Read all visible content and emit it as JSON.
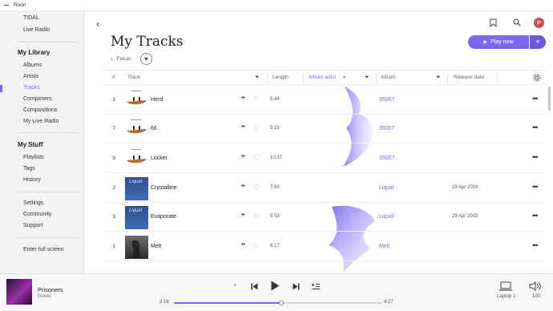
{
  "window": {
    "title": "Roon"
  },
  "sidebar": {
    "top_items": [
      {
        "label": "TIDAL"
      },
      {
        "label": "Live Radio"
      }
    ],
    "library_heading": "My Library",
    "library_items": [
      {
        "label": "Albums"
      },
      {
        "label": "Artists"
      },
      {
        "label": "Tracks",
        "active": true
      },
      {
        "label": "Composers"
      },
      {
        "label": "Compositions"
      },
      {
        "label": "My Live Radio"
      }
    ],
    "stuff_heading": "My Stuff",
    "stuff_items": [
      {
        "label": "Playlists"
      },
      {
        "label": "Tags"
      },
      {
        "label": "History"
      }
    ],
    "misc_items": [
      {
        "label": "Settings"
      },
      {
        "label": "Community"
      },
      {
        "label": "Support"
      }
    ],
    "fullscreen": "Enter full screen"
  },
  "header": {
    "title": "My Tracks",
    "focus_label": "Focus",
    "avatar_initial": "P",
    "play_label": "Play now"
  },
  "columns": {
    "num": "#",
    "track": "Track",
    "length": "Length",
    "album_artist": "Album artist",
    "album": "Album",
    "release_date": "Release date"
  },
  "tracks": [
    {
      "num": "1",
      "title": "Herd",
      "length": "5:44",
      "album": "35007",
      "date": "",
      "art": "canoe"
    },
    {
      "num": "7",
      "title": "66",
      "length": "5:15",
      "album": "35007",
      "date": "",
      "art": "canoe"
    },
    {
      "num": "9",
      "title": "Locker",
      "length": "10:37",
      "album": "35007",
      "date": "",
      "art": "canoe"
    },
    {
      "num": "2",
      "title": "Crystalline",
      "length": "7:50",
      "album": "Liquid",
      "date": "29 Apr 2003",
      "art": "liquid"
    },
    {
      "num": "3",
      "title": "Evaporate",
      "length": "5:53",
      "album": "Liquid",
      "date": "29 Apr 2003",
      "art": "liquid"
    },
    {
      "num": "1",
      "title": "Melt",
      "length": "6:17",
      "album": "Melt",
      "date": "",
      "art": "melt"
    }
  ],
  "player": {
    "title": "Prisoners",
    "artist": "Doves",
    "elapsed": "2:18",
    "total": "4:27",
    "progress": 0.517,
    "zone": "Laptop 1",
    "volume": "100"
  },
  "colors": {
    "accent": "#7b68ee",
    "avatar": "#c8504d"
  }
}
